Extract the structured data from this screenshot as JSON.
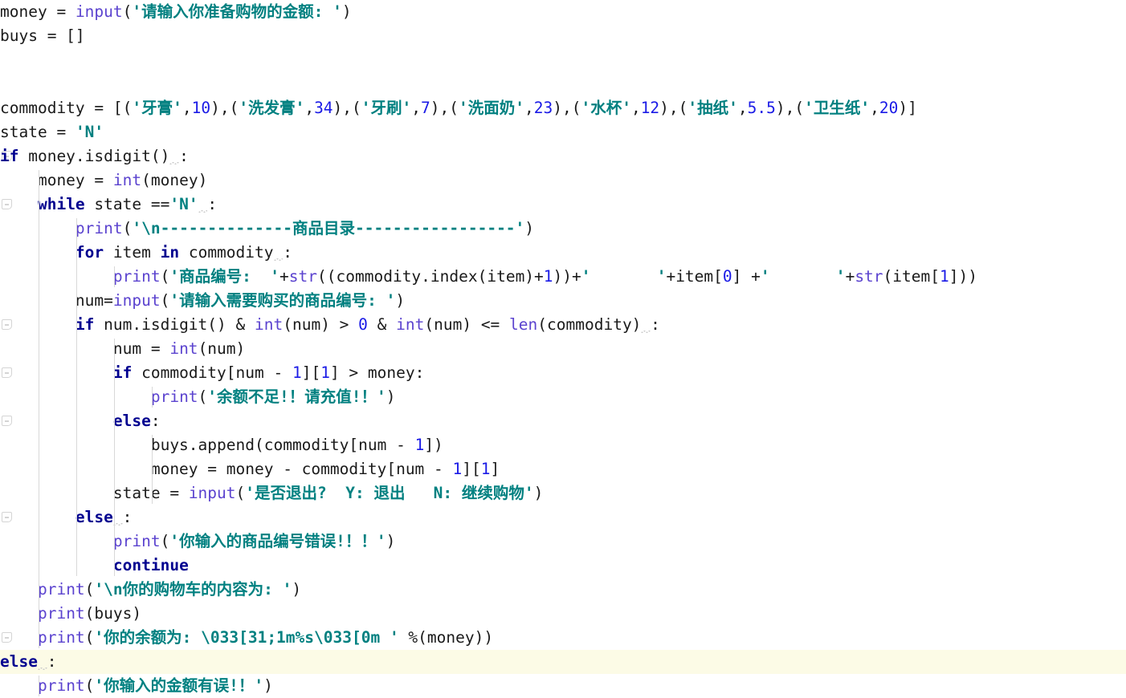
{
  "editor": {
    "language": "python",
    "background": "#ffffff",
    "current_line_highlight": "#fcfbe6",
    "colors": {
      "keyword": "#00008f",
      "builtin": "#5b43cf",
      "string": "#008080",
      "number": "#1a1ae6",
      "identifier": "#1a1a1a",
      "indent_guide": "#d8d8d8",
      "fold_marker": "#d4d4d4"
    },
    "lines": [
      {
        "n": 1,
        "indent": 0,
        "text": "money = input('请输入你准备购物的金额: ')",
        "tokens": [
          {
            "t": "money ",
            "c": "id"
          },
          {
            "t": "= ",
            "c": "pl"
          },
          {
            "t": "input",
            "c": "bi"
          },
          {
            "t": "(",
            "c": "pl"
          },
          {
            "t": "'请输入你准备购物的金额: '",
            "c": "str"
          },
          {
            "t": ")",
            "c": "pl"
          }
        ]
      },
      {
        "n": 2,
        "indent": 0,
        "text": "buys = []",
        "tokens": [
          {
            "t": "buys ",
            "c": "id"
          },
          {
            "t": "= []",
            "c": "pl"
          }
        ]
      },
      {
        "n": 3,
        "indent": 0,
        "text": "",
        "tokens": []
      },
      {
        "n": 4,
        "indent": 0,
        "text": "",
        "tokens": []
      },
      {
        "n": 5,
        "indent": 0,
        "text": "commodity = [('牙膏',10),('洗发膏',34),('牙刷',7),('洗面奶',23),('水杯',12),('抽纸',5.5),('卫生纸',20)]",
        "tokens": [
          {
            "t": "commodity ",
            "c": "id"
          },
          {
            "t": "= [(",
            "c": "pl"
          },
          {
            "t": "'牙膏'",
            "c": "str"
          },
          {
            "t": ",",
            "c": "pl"
          },
          {
            "t": "10",
            "c": "num"
          },
          {
            "t": "),(",
            "c": "pl"
          },
          {
            "t": "'洗发膏'",
            "c": "str"
          },
          {
            "t": ",",
            "c": "pl"
          },
          {
            "t": "34",
            "c": "num"
          },
          {
            "t": "),(",
            "c": "pl"
          },
          {
            "t": "'牙刷'",
            "c": "str"
          },
          {
            "t": ",",
            "c": "pl"
          },
          {
            "t": "7",
            "c": "num"
          },
          {
            "t": "),(",
            "c": "pl"
          },
          {
            "t": "'洗面奶'",
            "c": "str"
          },
          {
            "t": ",",
            "c": "pl"
          },
          {
            "t": "23",
            "c": "num"
          },
          {
            "t": "),(",
            "c": "pl"
          },
          {
            "t": "'水杯'",
            "c": "str"
          },
          {
            "t": ",",
            "c": "pl"
          },
          {
            "t": "12",
            "c": "num"
          },
          {
            "t": "),(",
            "c": "pl"
          },
          {
            "t": "'抽纸'",
            "c": "str"
          },
          {
            "t": ",",
            "c": "pl"
          },
          {
            "t": "5.5",
            "c": "num"
          },
          {
            "t": "),(",
            "c": "pl"
          },
          {
            "t": "'卫生纸'",
            "c": "str"
          },
          {
            "t": ",",
            "c": "pl"
          },
          {
            "t": "20",
            "c": "num"
          },
          {
            "t": ")]",
            "c": "pl"
          }
        ]
      },
      {
        "n": 6,
        "indent": 0,
        "text": "state = 'N'",
        "tokens": [
          {
            "t": "state ",
            "c": "id"
          },
          {
            "t": "= ",
            "c": "pl"
          },
          {
            "t": "'N'",
            "c": "str"
          }
        ]
      },
      {
        "n": 7,
        "indent": 0,
        "text": "if money.isdigit() :",
        "fold": true,
        "tokens": [
          {
            "t": "if",
            "c": "kw"
          },
          {
            "t": " money.isdigit()",
            "c": "id"
          },
          {
            "t": " ",
            "c": "sq"
          },
          {
            "t": ":",
            "c": "pl"
          }
        ]
      },
      {
        "n": 8,
        "indent": 1,
        "text": "    money = int(money)",
        "tokens": [
          {
            "t": "    money ",
            "c": "id"
          },
          {
            "t": "= ",
            "c": "pl"
          },
          {
            "t": "int",
            "c": "bi"
          },
          {
            "t": "(money)",
            "c": "pl"
          }
        ]
      },
      {
        "n": 9,
        "indent": 1,
        "text": "    while state =='N' :",
        "fold": true,
        "tokens": [
          {
            "t": "    ",
            "c": "pl"
          },
          {
            "t": "while",
            "c": "kw"
          },
          {
            "t": " state ==",
            "c": "id"
          },
          {
            "t": "'N'",
            "c": "str"
          },
          {
            "t": " ",
            "c": "sq"
          },
          {
            "t": ":",
            "c": "pl"
          }
        ]
      },
      {
        "n": 10,
        "indent": 2,
        "text": "        print('\\n--------------商品目录-----------------')",
        "tokens": [
          {
            "t": "        ",
            "c": "pl"
          },
          {
            "t": "print",
            "c": "bi"
          },
          {
            "t": "(",
            "c": "pl"
          },
          {
            "t": "'\\n",
            "c": "str"
          },
          {
            "t": "--------------商品目录-----------------'",
            "c": "str"
          },
          {
            "t": ")",
            "c": "pl"
          }
        ]
      },
      {
        "n": 11,
        "indent": 2,
        "text": "        for item in commodity :",
        "tokens": [
          {
            "t": "        ",
            "c": "pl"
          },
          {
            "t": "for",
            "c": "kw"
          },
          {
            "t": " item ",
            "c": "id"
          },
          {
            "t": "in",
            "c": "kw"
          },
          {
            "t": " commodity",
            "c": "id"
          },
          {
            "t": " ",
            "c": "sq"
          },
          {
            "t": ":",
            "c": "pl"
          }
        ]
      },
      {
        "n": 12,
        "indent": 3,
        "text": "            print('商品编号:  '+str((commodity.index(item)+1))+'       '+item[0] +'       '+str(item[1]))",
        "tokens": [
          {
            "t": "            ",
            "c": "pl"
          },
          {
            "t": "print",
            "c": "bi"
          },
          {
            "t": "(",
            "c": "pl"
          },
          {
            "t": "'商品编号:  '",
            "c": "str"
          },
          {
            "t": "+",
            "c": "pl"
          },
          {
            "t": "str",
            "c": "bi"
          },
          {
            "t": "((commodity.index(item)+",
            "c": "pl"
          },
          {
            "t": "1",
            "c": "num"
          },
          {
            "t": "))+",
            "c": "pl"
          },
          {
            "t": "'       '",
            "c": "str"
          },
          {
            "t": "+item[",
            "c": "pl"
          },
          {
            "t": "0",
            "c": "num"
          },
          {
            "t": "] +",
            "c": "pl"
          },
          {
            "t": "'       '",
            "c": "str"
          },
          {
            "t": "+",
            "c": "pl"
          },
          {
            "t": "str",
            "c": "bi"
          },
          {
            "t": "(item[",
            "c": "pl"
          },
          {
            "t": "1",
            "c": "num"
          },
          {
            "t": "]))",
            "c": "pl"
          }
        ]
      },
      {
        "n": 13,
        "indent": 2,
        "text": "        num=input('请输入需要购买的商品编号: ')",
        "tokens": [
          {
            "t": "        num=",
            "c": "id"
          },
          {
            "t": "input",
            "c": "bi"
          },
          {
            "t": "(",
            "c": "pl"
          },
          {
            "t": "'请输入需要购买的商品编号: '",
            "c": "str"
          },
          {
            "t": ")",
            "c": "pl"
          }
        ]
      },
      {
        "n": 14,
        "indent": 2,
        "text": "        if num.isdigit() & int(num) > 0 & int(num) <= len(commodity) :",
        "fold": true,
        "tokens": [
          {
            "t": "        ",
            "c": "pl"
          },
          {
            "t": "if",
            "c": "kw"
          },
          {
            "t": " num.isdigit() & ",
            "c": "id"
          },
          {
            "t": "int",
            "c": "bi"
          },
          {
            "t": "(num) > ",
            "c": "pl"
          },
          {
            "t": "0",
            "c": "num"
          },
          {
            "t": " & ",
            "c": "pl"
          },
          {
            "t": "int",
            "c": "bi"
          },
          {
            "t": "(num) <= ",
            "c": "pl"
          },
          {
            "t": "len",
            "c": "bi"
          },
          {
            "t": "(commodity)",
            "c": "pl"
          },
          {
            "t": " ",
            "c": "sq"
          },
          {
            "t": ":",
            "c": "pl"
          }
        ]
      },
      {
        "n": 15,
        "indent": 3,
        "text": "            num = int(num)",
        "tokens": [
          {
            "t": "            num ",
            "c": "id"
          },
          {
            "t": "= ",
            "c": "pl"
          },
          {
            "t": "int",
            "c": "bi"
          },
          {
            "t": "(num)",
            "c": "pl"
          }
        ]
      },
      {
        "n": 16,
        "indent": 3,
        "text": "            if commodity[num - 1][1] > money:",
        "fold": true,
        "tokens": [
          {
            "t": "            ",
            "c": "pl"
          },
          {
            "t": "if",
            "c": "kw"
          },
          {
            "t": " commodity[num - ",
            "c": "pl"
          },
          {
            "t": "1",
            "c": "num"
          },
          {
            "t": "][",
            "c": "pl"
          },
          {
            "t": "1",
            "c": "num"
          },
          {
            "t": "] > money:",
            "c": "pl"
          }
        ]
      },
      {
        "n": 17,
        "indent": 4,
        "text": "                print('余额不足!！请充值!！')",
        "tokens": [
          {
            "t": "                ",
            "c": "pl"
          },
          {
            "t": "print",
            "c": "bi"
          },
          {
            "t": "(",
            "c": "pl"
          },
          {
            "t": "'余额不足!！请充值!！'",
            "c": "str"
          },
          {
            "t": ")",
            "c": "pl"
          }
        ]
      },
      {
        "n": 18,
        "indent": 3,
        "text": "            else:",
        "fold": true,
        "tokens": [
          {
            "t": "            ",
            "c": "pl"
          },
          {
            "t": "else",
            "c": "kw"
          },
          {
            "t": ":",
            "c": "pl"
          }
        ]
      },
      {
        "n": 19,
        "indent": 4,
        "text": "                buys.append(commodity[num - 1])",
        "tokens": [
          {
            "t": "                buys.append(commodity[num - ",
            "c": "pl"
          },
          {
            "t": "1",
            "c": "num"
          },
          {
            "t": "])",
            "c": "pl"
          }
        ]
      },
      {
        "n": 20,
        "indent": 4,
        "text": "                money = money - commodity[num - 1][1]",
        "tokens": [
          {
            "t": "                money = money - commodity[num - ",
            "c": "pl"
          },
          {
            "t": "1",
            "c": "num"
          },
          {
            "t": "][",
            "c": "pl"
          },
          {
            "t": "1",
            "c": "num"
          },
          {
            "t": "]",
            "c": "pl"
          }
        ]
      },
      {
        "n": 21,
        "indent": 3,
        "text": "            state = input('是否退出?  Y: 退出   N: 继续购物')",
        "tokens": [
          {
            "t": "            state ",
            "c": "id"
          },
          {
            "t": "= ",
            "c": "pl"
          },
          {
            "t": "input",
            "c": "bi"
          },
          {
            "t": "(",
            "c": "pl"
          },
          {
            "t": "'是否退出?  Y: 退出   N: 继续购物'",
            "c": "str"
          },
          {
            "t": ")",
            "c": "pl"
          }
        ]
      },
      {
        "n": 22,
        "indent": 2,
        "text": "        else :",
        "fold": true,
        "tokens": [
          {
            "t": "        ",
            "c": "pl"
          },
          {
            "t": "else",
            "c": "kw"
          },
          {
            "t": " ",
            "c": "sq"
          },
          {
            "t": ":",
            "c": "pl"
          }
        ]
      },
      {
        "n": 23,
        "indent": 3,
        "text": "            print('你输入的商品编号错误!！！')",
        "tokens": [
          {
            "t": "            ",
            "c": "pl"
          },
          {
            "t": "print",
            "c": "bi"
          },
          {
            "t": "(",
            "c": "pl"
          },
          {
            "t": "'你输入的商品编号错误!！！'",
            "c": "str"
          },
          {
            "t": ")",
            "c": "pl"
          }
        ]
      },
      {
        "n": 24,
        "indent": 3,
        "text": "            continue",
        "tokens": [
          {
            "t": "            ",
            "c": "pl"
          },
          {
            "t": "continue",
            "c": "kw"
          }
        ]
      },
      {
        "n": 25,
        "indent": 1,
        "text": "    print('\\n你的购物车的内容为: ')",
        "tokens": [
          {
            "t": "    ",
            "c": "pl"
          },
          {
            "t": "print",
            "c": "bi"
          },
          {
            "t": "(",
            "c": "pl"
          },
          {
            "t": "'\\n你的购物车的内容为: '",
            "c": "str"
          },
          {
            "t": ")",
            "c": "pl"
          }
        ]
      },
      {
        "n": 26,
        "indent": 1,
        "text": "    print(buys)",
        "tokens": [
          {
            "t": "    ",
            "c": "pl"
          },
          {
            "t": "print",
            "c": "bi"
          },
          {
            "t": "(buys)",
            "c": "pl"
          }
        ]
      },
      {
        "n": 27,
        "indent": 1,
        "text": "    print('你的余额为: \\033[31;1m%s\\033[0m ' %(money))",
        "fold": true,
        "tokens": [
          {
            "t": "    ",
            "c": "pl"
          },
          {
            "t": "print",
            "c": "bi"
          },
          {
            "t": "(",
            "c": "pl"
          },
          {
            "t": "'你的余额为: \\033[31;1m%s\\033[0m '",
            "c": "str"
          },
          {
            "t": " %(money))",
            "c": "pl"
          }
        ]
      },
      {
        "n": 28,
        "indent": 0,
        "text": "else :",
        "highlight": true,
        "tokens": [
          {
            "t": "else",
            "c": "kw"
          },
          {
            "t": " ",
            "c": "sq"
          },
          {
            "t": ":",
            "c": "pl"
          }
        ]
      },
      {
        "n": 29,
        "indent": 1,
        "text": "    print('你输入的金额有误!！')",
        "tokens": [
          {
            "t": "    ",
            "c": "pl"
          },
          {
            "t": "print",
            "c": "bi"
          },
          {
            "t": "(",
            "c": "pl"
          },
          {
            "t": "'你输入的金额有误!！'",
            "c": "str"
          },
          {
            "t": ")",
            "c": "pl"
          }
        ]
      }
    ],
    "fold_marker_lines": [
      7,
      9,
      14,
      16,
      18,
      22,
      27
    ],
    "indent_guides": [
      {
        "col": 1,
        "from_line": 8,
        "to_line": 27
      },
      {
        "col": 2,
        "from_line": 10,
        "to_line": 24
      },
      {
        "col": 3,
        "from_line": 12,
        "to_line": 12
      },
      {
        "col": 3,
        "from_line": 15,
        "to_line": 24
      },
      {
        "col": 4,
        "from_line": 17,
        "to_line": 17
      },
      {
        "col": 4,
        "from_line": 19,
        "to_line": 21
      },
      {
        "col": 1,
        "from_line": 29,
        "to_line": 29
      }
    ]
  }
}
